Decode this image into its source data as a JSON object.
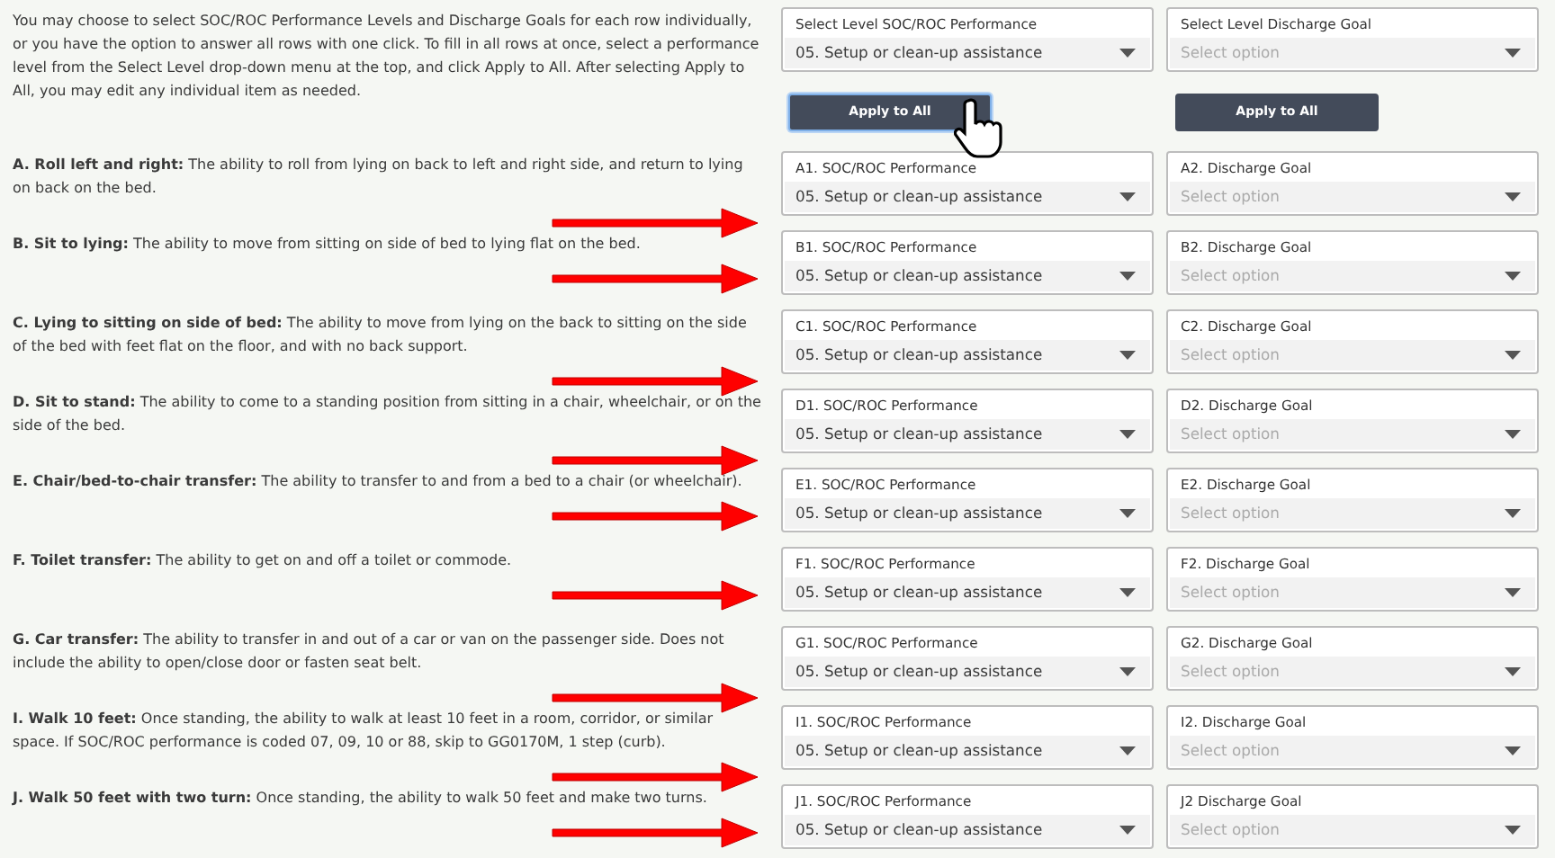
{
  "intro": "You may choose to select SOC/ROC Performance Levels and Discharge Goals for each row individually, or you have the option to answer all rows with one click. To fill in all rows at once, select a performance level from the Select Level drop-down menu at the top, and click Apply to All. After selecting Apply to All, you may edit any individual item as needed.",
  "top": {
    "performance": {
      "label": "Select Level SOC/ROC Performance",
      "value": "05. Setup or clean-up assistance"
    },
    "goal": {
      "label": "Select Level Discharge Goal",
      "placeholder": "Select option"
    }
  },
  "apply_buttons": [
    {
      "label": "Apply to All",
      "focused": true
    },
    {
      "label": "Apply to All",
      "focused": false
    }
  ],
  "rows": [
    {
      "text": "**A. Roll left and right:** The ability to roll from lying on back to left and right side, and return to lying on back on the bed.",
      "performance": {
        "label": "A1. SOC/ROC Performance",
        "value": "05. Setup or clean-up assistance"
      },
      "goal": {
        "label": "A2. Discharge Goal",
        "placeholder": "Select option"
      }
    },
    {
      "text": "**B. Sit to lying:** The ability to move from sitting on side of bed to lying flat on the bed.",
      "performance": {
        "label": "B1. SOC/ROC Performance",
        "value": "05. Setup or clean-up assistance"
      },
      "goal": {
        "label": "B2. Discharge Goal",
        "placeholder": "Select option"
      }
    },
    {
      "text": "**C. Lying to sitting on side of bed:** The ability to move from lying on the back to sitting on the side of the bed with feet flat on the floor, and with no back support.",
      "performance": {
        "label": "C1. SOC/ROC Performance",
        "value": "05. Setup or clean-up assistance"
      },
      "goal": {
        "label": "C2. Discharge Goal",
        "placeholder": "Select option"
      }
    },
    {
      "text": "**D. Sit to stand:** The ability to come to a standing position from sitting in a chair, wheelchair, or on the side of the bed.",
      "performance": {
        "label": "D1. SOC/ROC Performance",
        "value": "05. Setup or clean-up assistance"
      },
      "goal": {
        "label": "D2. Discharge Goal",
        "placeholder": "Select option"
      }
    },
    {
      "text": "**E. Chair/bed-to-chair transfer:** The ability to transfer to and from a bed to a chair (or wheelchair).",
      "performance": {
        "label": "E1. SOC/ROC Performance",
        "value": "05. Setup or clean-up assistance"
      },
      "goal": {
        "label": "E2. Discharge Goal",
        "placeholder": "Select option"
      }
    },
    {
      "text": "**F. Toilet transfer:** The ability to get on and off a toilet or commode.",
      "performance": {
        "label": "F1. SOC/ROC Performance",
        "value": "05. Setup or clean-up assistance"
      },
      "goal": {
        "label": "F2. Discharge Goal",
        "placeholder": "Select option"
      }
    },
    {
      "text": "**G. Car transfer:** The ability to transfer in and out of a car or van on the passenger side. Does not include the ability to open/close door or fasten seat belt.",
      "performance": {
        "label": "G1. SOC/ROC Performance",
        "value": "05. Setup or clean-up assistance"
      },
      "goal": {
        "label": "G2. Discharge Goal",
        "placeholder": "Select option"
      }
    },
    {
      "text": "**I. Walk 10 feet:** Once standing, the ability to walk at least 10 feet in a room, corridor, or similar space. If SOC/ROC performance is coded 07, 09, 10 or 88, skip to GG0170M, 1 step (curb).",
      "performance": {
        "label": "I1. SOC/ROC Performance",
        "value": "05. Setup or clean-up assistance"
      },
      "goal": {
        "label": "I2. Discharge Goal",
        "placeholder": "Select option"
      }
    },
    {
      "text": "**J. Walk 50 feet with two turn:** Once standing, the ability to walk 50 feet and make two turns.",
      "performance": {
        "label": "J1. SOC/ROC Performance",
        "value": "05. Setup or clean-up assistance"
      },
      "goal": {
        "label": "J2 Discharge Goal",
        "placeholder": "Select option"
      }
    }
  ]
}
